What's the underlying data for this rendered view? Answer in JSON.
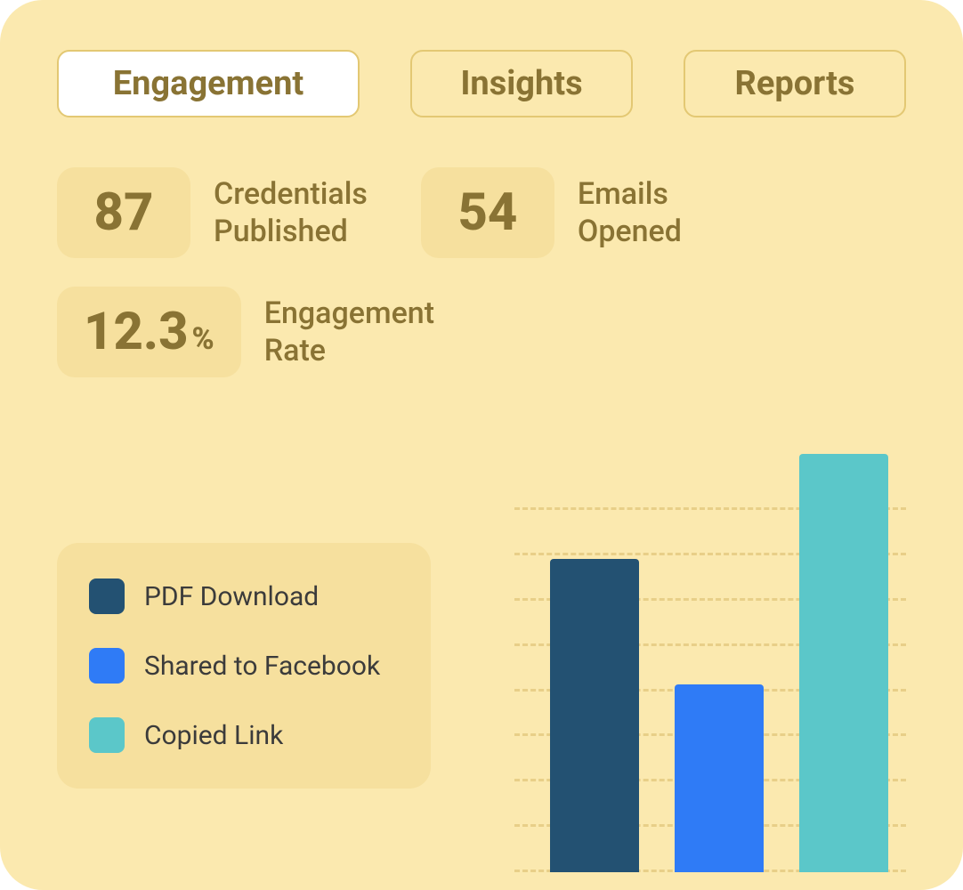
{
  "tabs": {
    "engagement": "Engagement",
    "insights": "Insights",
    "reports": "Reports",
    "active": "engagement"
  },
  "stats": {
    "credentials": {
      "value": "87",
      "label": "Credentials\nPublished"
    },
    "emails": {
      "value": "54",
      "label": "Emails\nOpened"
    },
    "rate": {
      "value": "12.3",
      "unit": "%",
      "label": "Engagement\nRate"
    }
  },
  "legend": [
    {
      "name": "PDF Download",
      "color": "#235172"
    },
    {
      "name": "Shared to Facebook",
      "color": "#2f7bf6"
    },
    {
      "name": "Copied Link",
      "color": "#5bc7c9"
    }
  ],
  "chart_data": {
    "type": "bar",
    "categories": [
      "PDF Download",
      "Shared to Facebook",
      "Copied Link"
    ],
    "series": [
      {
        "name": "PDF Download",
        "color": "#235172",
        "value": 75
      },
      {
        "name": "Shared to Facebook",
        "color": "#2f7bf6",
        "value": 45
      },
      {
        "name": "Copied Link",
        "color": "#5bc7c9",
        "value": 100
      }
    ],
    "ylim": [
      0,
      100
    ],
    "grid_divisions": 9,
    "title": "",
    "xlabel": "",
    "ylabel": ""
  }
}
